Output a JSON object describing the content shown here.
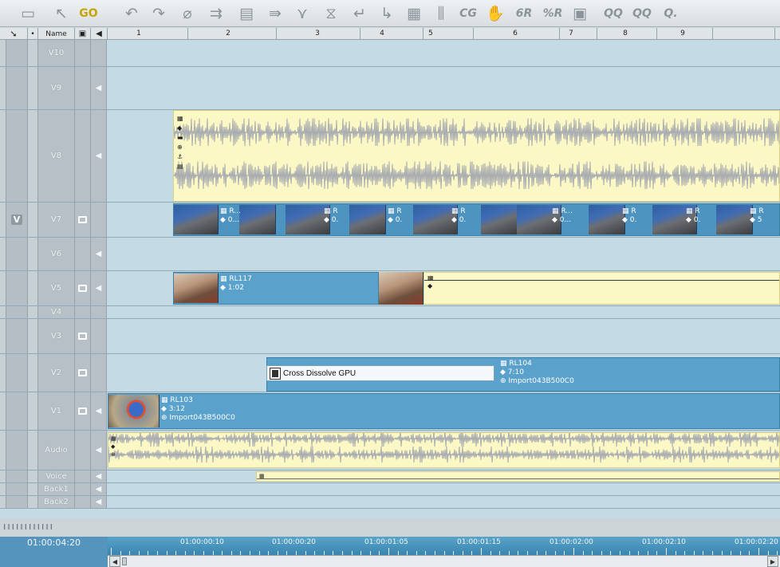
{
  "toolbar": {
    "icons": [
      "bin-icon",
      "pointer-icon",
      "link-icon",
      "undo-icon",
      "redo-icon",
      "razor-icon",
      "ripple-icon",
      "lift-icon",
      "extract-icon",
      "filter-icon",
      "split-icon",
      "in-point-icon",
      "out-point-icon",
      "grid-icon",
      "mixer-icon",
      "cg-icon",
      "hand-icon",
      "render-icon",
      "render-all-icon",
      "box-icon",
      "record-icon",
      "record-all-icon",
      "more-icon"
    ],
    "glyphs": [
      "▭",
      "↖",
      "GO",
      "↶",
      "↷",
      "⌀",
      "⇉",
      "▤",
      "⇛",
      "⋎",
      "⧖",
      "↵",
      "↳",
      "▦",
      "⫼",
      "CG",
      "✋",
      "6R",
      "%R",
      "▣",
      "QQ",
      "QQ",
      "Q."
    ]
  },
  "header": {
    "arrow": "➘",
    "dot": "•",
    "name": "Name",
    "mon_icon": "▣",
    "aud_icon": "◀",
    "ruler_numbers": [
      "1",
      "2",
      "3",
      "4",
      "5",
      "6",
      "7",
      "8",
      "9"
    ]
  },
  "tracks": [
    {
      "name": "V10",
      "mon": false,
      "aud": false,
      "v_selected": false
    },
    {
      "name": "V9",
      "mon": false,
      "aud": true,
      "v_selected": false
    },
    {
      "name": "V8",
      "mon": false,
      "aud": true,
      "v_selected": false
    },
    {
      "name": "V7",
      "mon": true,
      "aud": false,
      "v_selected": true,
      "v_label": "V"
    },
    {
      "name": "V6",
      "mon": false,
      "aud": true,
      "v_selected": false
    },
    {
      "name": "V5",
      "mon": true,
      "aud": true,
      "v_selected": false
    },
    {
      "name": "V4",
      "mon": false,
      "aud": false,
      "v_selected": false
    },
    {
      "name": "V3",
      "mon": true,
      "aud": false,
      "v_selected": false
    },
    {
      "name": "V2",
      "mon": true,
      "aud": false,
      "v_selected": false
    },
    {
      "name": "V1",
      "mon": true,
      "aud": true,
      "v_selected": false
    },
    {
      "name": "Audio",
      "mon": false,
      "aud": true,
      "v_selected": false
    },
    {
      "name": "Voice",
      "mon": false,
      "aud": true,
      "v_selected": false
    },
    {
      "name": "Back1",
      "mon": false,
      "aud": true,
      "v_selected": false
    },
    {
      "name": "Back2",
      "mon": false,
      "aud": true,
      "v_selected": false
    }
  ],
  "clips": {
    "v5_a": {
      "name": "RL117",
      "duration": "1:02"
    },
    "v2": {
      "name": "RL104",
      "duration": "7:10",
      "source": "Import043B500C0"
    },
    "v2_transition": "Cross Dissolve GPU",
    "v1": {
      "name": "RL103",
      "duration": "3:12",
      "source": "Import043B500C0"
    },
    "v7_thumb_labels": [
      "R...",
      "R",
      "R",
      "R",
      "R...",
      "R",
      "R",
      "R"
    ],
    "v7_thumb_durations": [
      "0...",
      "0.",
      "0.",
      "0.",
      "0...",
      "0.",
      "0.",
      "5"
    ]
  },
  "bottom": {
    "timecode": "01:00:04:20",
    "ruler_labels": [
      "01:00:00:10",
      "01:00:00:20",
      "01:00:01:05",
      "01:00:01:15",
      "01:00:02:00",
      "01:00:02:10",
      "01:00:02:20"
    ],
    "scroll_left": "◀",
    "scroll_right": "▶"
  }
}
